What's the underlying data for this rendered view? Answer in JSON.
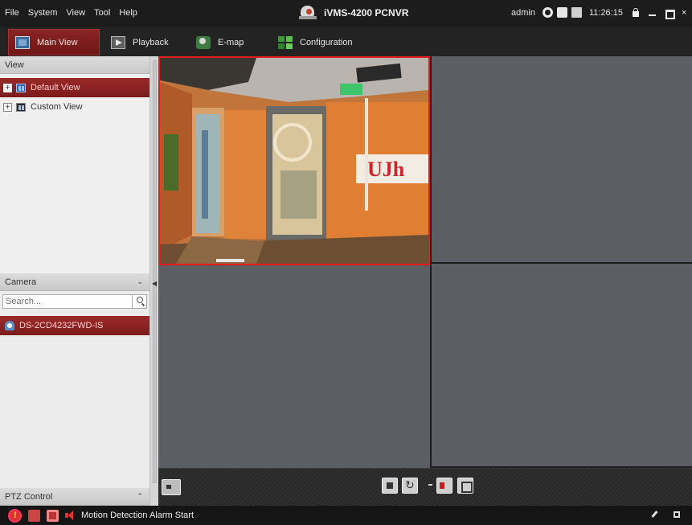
{
  "menu": [
    "File",
    "System",
    "View",
    "Tool",
    "Help"
  ],
  "app": {
    "title": "iVMS-4200 PCNVR"
  },
  "system": {
    "user": "admin",
    "time": "11:26:15",
    "close_glyph": "×"
  },
  "tabs": [
    {
      "label": "Main View",
      "icon": "main-view-icon",
      "active": true
    },
    {
      "label": "Playback",
      "icon": "playback-icon",
      "active": false
    },
    {
      "label": "E-map",
      "icon": "emap-icon",
      "active": false
    },
    {
      "label": "Configuration",
      "icon": "configuration-icon",
      "active": false
    }
  ],
  "view_panel": {
    "title": "View",
    "items": [
      {
        "label": "Default View",
        "expander": "+",
        "selected": true
      },
      {
        "label": "Custom View",
        "expander": "+",
        "selected": false
      }
    ]
  },
  "camera_panel": {
    "title": "Camera",
    "collapse_glyph": "⌄",
    "search": {
      "placeholder": "Search...",
      "value": ""
    },
    "cameras": [
      {
        "label": "DS-2CD4232FWD-IS",
        "selected": true
      }
    ]
  },
  "ptz_panel": {
    "title": "PTZ Control",
    "expand_glyph": "⌃"
  },
  "splitter": {
    "arrow_glyph": "◀"
  },
  "statusbar": {
    "message": "Motion Detection Alarm Start"
  },
  "colors": {
    "accent_red": "#8a2424",
    "active_pane_border": "#e31b1b",
    "pane_empty": "#5b5f63",
    "background": "#2b2b2b"
  }
}
